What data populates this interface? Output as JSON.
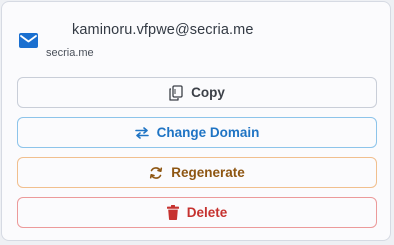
{
  "email": {
    "address": "kaminoru.vfpwe@secria.me",
    "domain": "secria.me"
  },
  "actions": {
    "copy_label": "Copy",
    "change_domain_label": "Change Domain",
    "regenerate_label": "Regenerate",
    "delete_label": "Delete"
  },
  "colors": {
    "mail_icon": "#1a6fd0",
    "copy": "#3c4048",
    "change_domain": "#1f74c4",
    "regenerate": "#8e5612",
    "delete": "#c6322f"
  },
  "icons": {
    "header": "mail-icon",
    "copy": "copy-icon",
    "change_domain": "swap-arrows-icon",
    "regenerate": "refresh-icon",
    "delete": "trash-icon"
  }
}
